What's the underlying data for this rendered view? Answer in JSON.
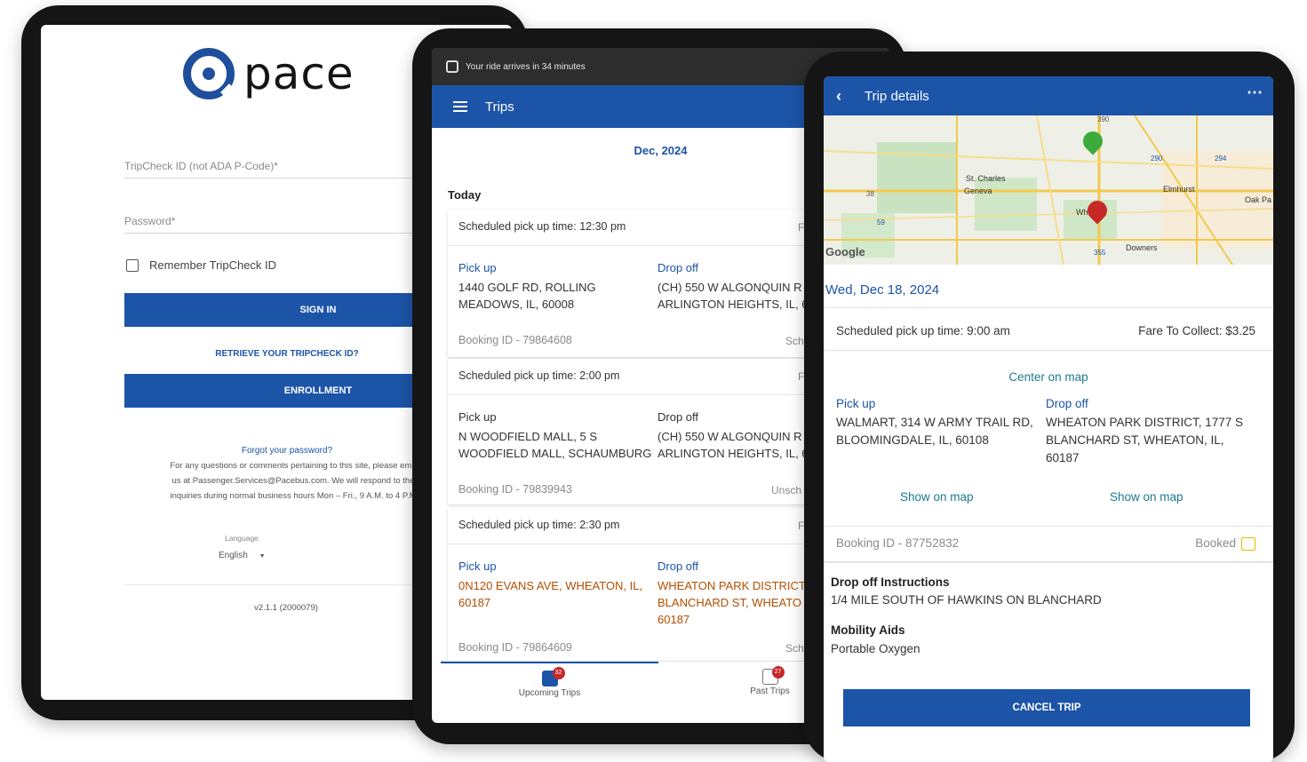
{
  "colors": {
    "brand_blue": "#1c54a8",
    "status_bar": "#2d2d2d",
    "accent_red": "#c62828",
    "pin_green": "#3cab3c",
    "address_orange": "#b34f00"
  },
  "login": {
    "brand": "pace",
    "tripcheck_label": "TripCheck ID (not ADA P-Code)*",
    "password_label": "Password*",
    "remember_label": "Remember TripCheck ID",
    "sign_in": "SIGN IN",
    "retrieve_link": "RETRIEVE YOUR TRIPCHECK ID?",
    "enrollment": "ENROLLMENT",
    "forgot_link": "Forgot your password?",
    "help_lines": [
      "For any questions or comments pertaining to this site, please ema",
      "us at Passenger.Services@Pacebus.com. We will respond to the",
      "inquiries during normal business hours Mon – Fri., 9 A.M. to 4 P.M"
    ],
    "language_label": "Language",
    "language_value": "English",
    "version": "v2.1.1 (2000079)"
  },
  "trips": {
    "status_text": "Your ride arrives in 34 minutes",
    "title": "Trips",
    "month": "Dec, 2024",
    "section": "Today",
    "cards": [
      {
        "sched": "Scheduled pick up time: 12:30 pm",
        "tail": "F",
        "pickup_label": "Pick up",
        "pickup": "1440 GOLF RD, ROLLING\nMEADOWS, IL, 60008",
        "dropoff_label": "Drop off",
        "dropoff": "(CH) 550 W ALGONQUIN R\nARLINGTON HEIGHTS, IL, 6",
        "booking": "Booking ID - 79864608",
        "status": "Sch"
      },
      {
        "sched": "Scheduled pick up time: 2:00 pm",
        "tail": "F",
        "pickup_label": "Pick up",
        "pickup": "N WOODFIELD MALL, 5 S\nWOODFIELD MALL, SCHAUMBURG",
        "dropoff_label": "Drop off",
        "dropoff": "(CH) 550 W ALGONQUIN R\nARLINGTON HEIGHTS, IL, 6",
        "booking": "Booking ID - 79839943",
        "status": "Unsch"
      },
      {
        "sched": "Scheduled pick up time: 2:30 pm",
        "tail": "F",
        "pickup_label": "Pick up",
        "pickup": "0N120 EVANS AVE, WHEATON, IL,\n60187",
        "dropoff_label": "Drop off",
        "dropoff": "WHEATON PARK DISTRICT\nBLANCHARD ST, WHEATO\n60187",
        "booking": "Booking ID - 79864609",
        "status": "Sch"
      }
    ],
    "nav": [
      {
        "label": "Upcoming Trips",
        "badge": "32"
      },
      {
        "label": "Past Trips",
        "badge": "27"
      }
    ]
  },
  "details": {
    "title": "Trip details",
    "more": "⋯",
    "map_labels": {
      "st_charles": "St. Charles",
      "geneva": "Geneva",
      "elmhurst": "Elmhurst",
      "oak_park": "Oak Pa",
      "downers": "Downers",
      "wh": "Wh",
      "google": "Google",
      "r390": "390",
      "r290": "290",
      "r294": "294",
      "r38": "38",
      "r59": "59",
      "r355": "355"
    },
    "date": "Wed, Dec 18, 2024",
    "sched": "Scheduled pick up time: 9:00 am",
    "fare": "Fare To Collect: $3.25",
    "center_map": "Center on map",
    "pickup_label": "Pick up",
    "pickup": "WALMART, 314 W ARMY TRAIL RD,\nBLOOMINGDALE, IL, 60108",
    "dropoff_label": "Drop off",
    "dropoff": "WHEATON PARK DISTRICT, 1777 S\nBLANCHARD ST, WHEATON, IL,\n60187",
    "show_map": "Show on map",
    "booking": "Booking ID - 87752832",
    "status": "Booked",
    "instr_label": "Drop off Instructions",
    "instr": "1/4 MILE SOUTH OF HAWKINS ON BLANCHARD",
    "aids_label": "Mobility Aids",
    "aids": "Portable Oxygen",
    "cancel": "CANCEL TRIP"
  }
}
